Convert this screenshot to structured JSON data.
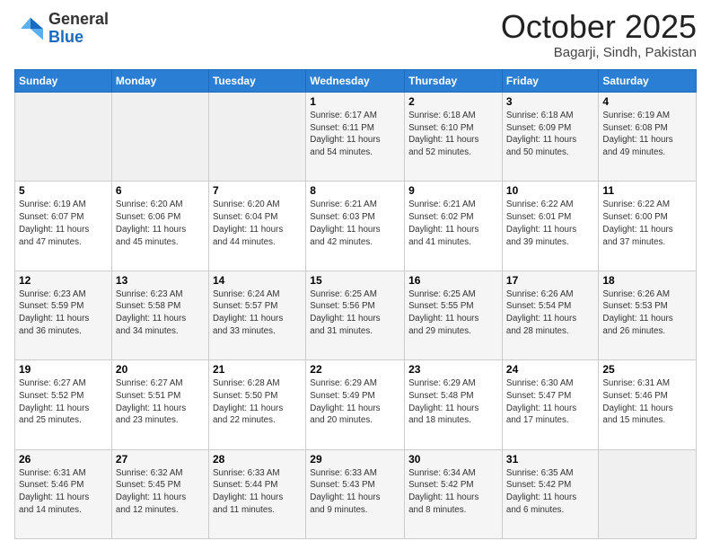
{
  "header": {
    "logo_general": "General",
    "logo_blue": "Blue",
    "month": "October 2025",
    "location": "Bagarji, Sindh, Pakistan"
  },
  "weekdays": [
    "Sunday",
    "Monday",
    "Tuesday",
    "Wednesday",
    "Thursday",
    "Friday",
    "Saturday"
  ],
  "weeks": [
    [
      {
        "day": "",
        "info": ""
      },
      {
        "day": "",
        "info": ""
      },
      {
        "day": "",
        "info": ""
      },
      {
        "day": "1",
        "info": "Sunrise: 6:17 AM\nSunset: 6:11 PM\nDaylight: 11 hours\nand 54 minutes."
      },
      {
        "day": "2",
        "info": "Sunrise: 6:18 AM\nSunset: 6:10 PM\nDaylight: 11 hours\nand 52 minutes."
      },
      {
        "day": "3",
        "info": "Sunrise: 6:18 AM\nSunset: 6:09 PM\nDaylight: 11 hours\nand 50 minutes."
      },
      {
        "day": "4",
        "info": "Sunrise: 6:19 AM\nSunset: 6:08 PM\nDaylight: 11 hours\nand 49 minutes."
      }
    ],
    [
      {
        "day": "5",
        "info": "Sunrise: 6:19 AM\nSunset: 6:07 PM\nDaylight: 11 hours\nand 47 minutes."
      },
      {
        "day": "6",
        "info": "Sunrise: 6:20 AM\nSunset: 6:06 PM\nDaylight: 11 hours\nand 45 minutes."
      },
      {
        "day": "7",
        "info": "Sunrise: 6:20 AM\nSunset: 6:04 PM\nDaylight: 11 hours\nand 44 minutes."
      },
      {
        "day": "8",
        "info": "Sunrise: 6:21 AM\nSunset: 6:03 PM\nDaylight: 11 hours\nand 42 minutes."
      },
      {
        "day": "9",
        "info": "Sunrise: 6:21 AM\nSunset: 6:02 PM\nDaylight: 11 hours\nand 41 minutes."
      },
      {
        "day": "10",
        "info": "Sunrise: 6:22 AM\nSunset: 6:01 PM\nDaylight: 11 hours\nand 39 minutes."
      },
      {
        "day": "11",
        "info": "Sunrise: 6:22 AM\nSunset: 6:00 PM\nDaylight: 11 hours\nand 37 minutes."
      }
    ],
    [
      {
        "day": "12",
        "info": "Sunrise: 6:23 AM\nSunset: 5:59 PM\nDaylight: 11 hours\nand 36 minutes."
      },
      {
        "day": "13",
        "info": "Sunrise: 6:23 AM\nSunset: 5:58 PM\nDaylight: 11 hours\nand 34 minutes."
      },
      {
        "day": "14",
        "info": "Sunrise: 6:24 AM\nSunset: 5:57 PM\nDaylight: 11 hours\nand 33 minutes."
      },
      {
        "day": "15",
        "info": "Sunrise: 6:25 AM\nSunset: 5:56 PM\nDaylight: 11 hours\nand 31 minutes."
      },
      {
        "day": "16",
        "info": "Sunrise: 6:25 AM\nSunset: 5:55 PM\nDaylight: 11 hours\nand 29 minutes."
      },
      {
        "day": "17",
        "info": "Sunrise: 6:26 AM\nSunset: 5:54 PM\nDaylight: 11 hours\nand 28 minutes."
      },
      {
        "day": "18",
        "info": "Sunrise: 6:26 AM\nSunset: 5:53 PM\nDaylight: 11 hours\nand 26 minutes."
      }
    ],
    [
      {
        "day": "19",
        "info": "Sunrise: 6:27 AM\nSunset: 5:52 PM\nDaylight: 11 hours\nand 25 minutes."
      },
      {
        "day": "20",
        "info": "Sunrise: 6:27 AM\nSunset: 5:51 PM\nDaylight: 11 hours\nand 23 minutes."
      },
      {
        "day": "21",
        "info": "Sunrise: 6:28 AM\nSunset: 5:50 PM\nDaylight: 11 hours\nand 22 minutes."
      },
      {
        "day": "22",
        "info": "Sunrise: 6:29 AM\nSunset: 5:49 PM\nDaylight: 11 hours\nand 20 minutes."
      },
      {
        "day": "23",
        "info": "Sunrise: 6:29 AM\nSunset: 5:48 PM\nDaylight: 11 hours\nand 18 minutes."
      },
      {
        "day": "24",
        "info": "Sunrise: 6:30 AM\nSunset: 5:47 PM\nDaylight: 11 hours\nand 17 minutes."
      },
      {
        "day": "25",
        "info": "Sunrise: 6:31 AM\nSunset: 5:46 PM\nDaylight: 11 hours\nand 15 minutes."
      }
    ],
    [
      {
        "day": "26",
        "info": "Sunrise: 6:31 AM\nSunset: 5:46 PM\nDaylight: 11 hours\nand 14 minutes."
      },
      {
        "day": "27",
        "info": "Sunrise: 6:32 AM\nSunset: 5:45 PM\nDaylight: 11 hours\nand 12 minutes."
      },
      {
        "day": "28",
        "info": "Sunrise: 6:33 AM\nSunset: 5:44 PM\nDaylight: 11 hours\nand 11 minutes."
      },
      {
        "day": "29",
        "info": "Sunrise: 6:33 AM\nSunset: 5:43 PM\nDaylight: 11 hours\nand 9 minutes."
      },
      {
        "day": "30",
        "info": "Sunrise: 6:34 AM\nSunset: 5:42 PM\nDaylight: 11 hours\nand 8 minutes."
      },
      {
        "day": "31",
        "info": "Sunrise: 6:35 AM\nSunset: 5:42 PM\nDaylight: 11 hours\nand 6 minutes."
      },
      {
        "day": "",
        "info": ""
      }
    ]
  ]
}
